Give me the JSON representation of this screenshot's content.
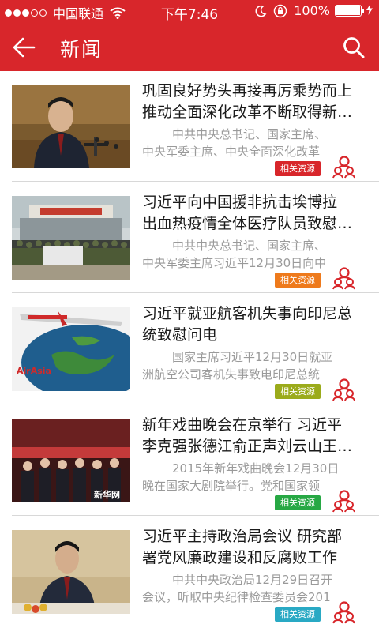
{
  "status_bar": {
    "carrier": "中国联通",
    "time": "下午7:46",
    "battery_percent": "100%",
    "battery_level": 1.0,
    "signal_dots_filled": 3,
    "signal_dots_total": 5
  },
  "nav": {
    "title": "新闻",
    "back_icon": "back-arrow-icon",
    "search_icon": "search-icon"
  },
  "colors": {
    "brand_red": "#d8262b",
    "tag_red": "#d8262b",
    "tag_orange": "#ee7a1c",
    "tag_olive": "#9bab1b",
    "tag_green": "#27a844",
    "tag_cyan": "#29a9c4"
  },
  "news": [
    {
      "headline_line1": "巩固良好势头再接再厉乘势而上",
      "headline_line2": "推动全面深化改革不断取得新…",
      "summary_line1": "中共中央总书记、国家主席、",
      "summary_line2": "中央军委主席、中央全面深化改革",
      "tag": "相关资源",
      "tag_color": "#d8262b"
    },
    {
      "headline_line1": "习近平向中国援非抗击埃博拉",
      "headline_line2": "出血热疫情全体医疗队员致慰…",
      "summary_line1": "中共中央总书记、国家主席、",
      "summary_line2": "中央军委主席习近平12月30日向中",
      "tag": "相关资源",
      "tag_color": "#ee7a1c"
    },
    {
      "headline_line1": "习近平就亚航客机失事向印尼总",
      "headline_line2": "统致慰问电",
      "summary_line1": "国家主席习近平12月30日就亚",
      "summary_line2": "洲航空公司客机失事致电印尼总统",
      "tag": "相关资源",
      "tag_color": "#9bab1b"
    },
    {
      "headline_line1": "新年戏曲晚会在京举行 习近平",
      "headline_line2": "李克强张德江俞正声刘云山王…",
      "summary_line1": "2015年新年戏曲晚会12月30日",
      "summary_line2": "晚在国家大剧院举行。党和国家领",
      "tag": "相关资源",
      "tag_color": "#27a844"
    },
    {
      "headline_line1": "习近平主持政治局会议 研究部",
      "headline_line2": "署党风廉政建设和反腐败工作",
      "summary_line1": "中共中央政治局12月29日召开",
      "summary_line2": "会议，听取中央纪律检查委员会201",
      "tag": "相关资源",
      "tag_color": "#29a9c4"
    }
  ],
  "icons": {
    "resource_people": "people-group-icon",
    "thumbnails": [
      "photo-leader-speech",
      "photo-medical-team",
      "photo-airasia-plane-map",
      "photo-opera-gala",
      "photo-leader-meeting"
    ]
  }
}
